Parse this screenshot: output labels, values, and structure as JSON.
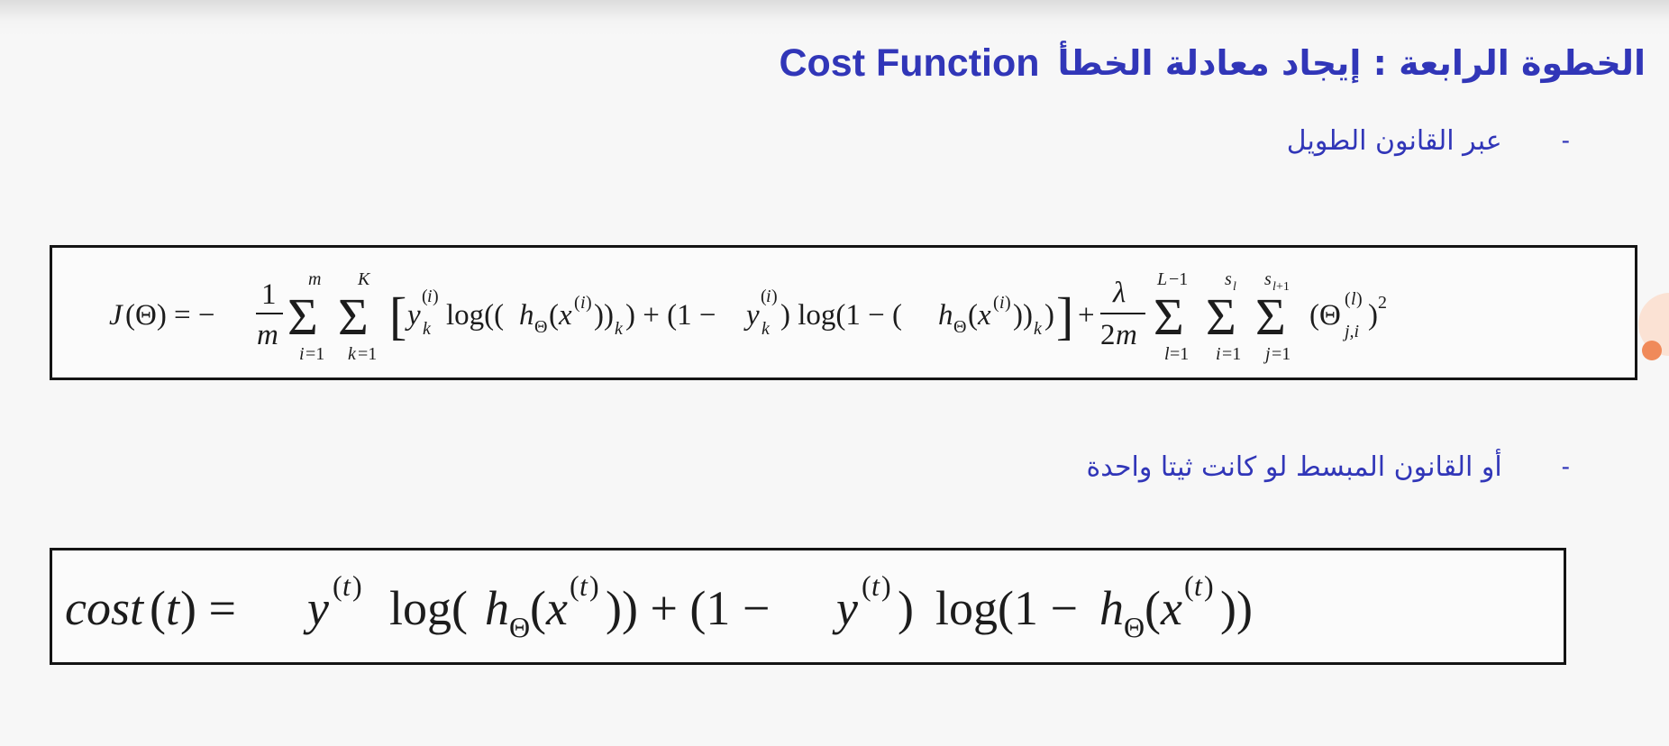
{
  "slide": {
    "title_arabic": "الخطوة الرابعة : إيجاد معادلة الخطأ",
    "title_english": "Cost Function",
    "bullets": [
      {
        "dash": "-",
        "text": "عبر القانون الطويل"
      },
      {
        "dash": "-",
        "text": "أو القانون المبسط لو كانت ثيتا واحدة"
      }
    ],
    "formula_full": "J(Θ) = − (1/m) Σ_{i=1}^{m} Σ_{k=1}^{K} [ y_k^{(i)} log((h_Θ(x^{(i)}))_k) + (1 − y_k^{(i)}) log(1 − (h_Θ(x^{(i)}))_k) ] + (λ/2m) Σ_{l=1}^{L−1} Σ_{i=1}^{s_l} Σ_{j=1}^{s_{l+1}} (Θ_{j,i}^{(l)})^2",
    "formula_simple": "cost(t) = y^{(t)} log(h_Θ(x^{(t)})) + (1 − y^{(t)}) log(1 − h_Θ(x^{(t)}))"
  },
  "colors": {
    "text_accent": "#3136b8",
    "formula_text": "#1c1c1c",
    "box_border": "#141414",
    "background": "#f7f7f7",
    "side_marker": "#f08a5a"
  }
}
